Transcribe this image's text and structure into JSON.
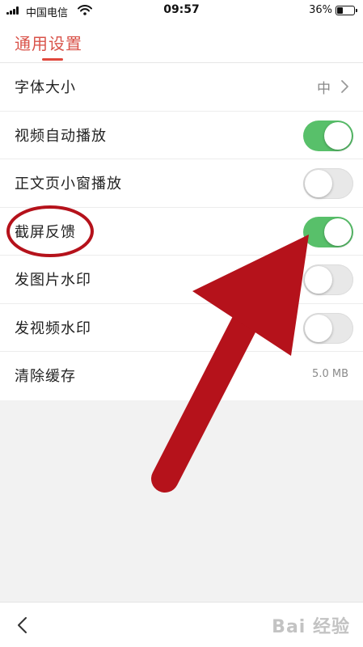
{
  "status_bar": {
    "carrier": "中国电信",
    "time": "09:57",
    "battery": "36%",
    "battery_level": 0.36
  },
  "header": {
    "title": "通用设置"
  },
  "settings": [
    {
      "label": "字体大小",
      "value": "中",
      "control": "chevron"
    },
    {
      "label": "视频自动播放",
      "control": "toggle",
      "on": true
    },
    {
      "label": "正文页小窗播放",
      "control": "toggle",
      "on": false
    },
    {
      "label": "截屏反馈",
      "control": "toggle",
      "on": true
    },
    {
      "label": "发图片水印",
      "control": "toggle",
      "on": false
    },
    {
      "label": "发视频水印",
      "control": "toggle",
      "on": false
    },
    {
      "label": "清除缓存",
      "value": "5.0 MB",
      "control": "value"
    }
  ],
  "bottom_bar": {
    "watermark": "Bai 经验"
  },
  "colors": {
    "accent": "#d9534a",
    "toggle_on": "#58c06a",
    "annotation": "#b5121b"
  }
}
